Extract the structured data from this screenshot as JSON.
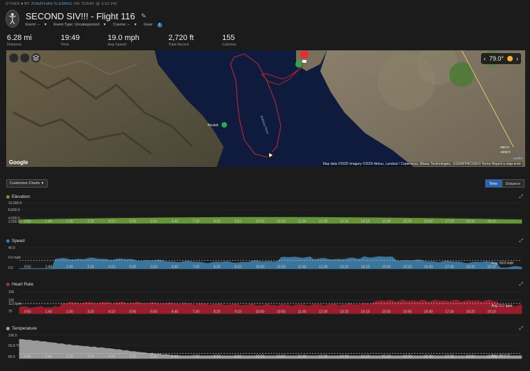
{
  "header": {
    "byline_prefix": "OTHER",
    "byline_author": "BY JONATHAN FLEMING",
    "byline_suffix": "ON TODAY @ 3:52 PM",
    "title": "SECOND SIV!!! - Flight 116",
    "event": "Event: --",
    "event_type": "Event Type: Uncategorized",
    "course": "Course: --",
    "gear": "Gear:",
    "gear_count": "1"
  },
  "stats": [
    {
      "value": "6.28 mi",
      "label": "Distance"
    },
    {
      "value": "19:49",
      "label": "Time"
    },
    {
      "value": "19.0 mph",
      "label": "Avg Speed"
    },
    {
      "value": "2,720 ft",
      "label": "Total Ascent"
    },
    {
      "value": "155",
      "label": "Calories"
    }
  ],
  "map": {
    "temperature": "79.0°",
    "attribution": "Map data ©2025 Imagery ©2025 Airbus, Landsat / Copernicus, Maxar Technologies, USDA/FPAC/GEO   Terms   Report a map error",
    "google_label": "Google",
    "scale_m": "500 m",
    "scale_ft": "2000 ft",
    "leaflet": "Leaflet",
    "river_label": "Malheur River"
  },
  "controls": {
    "customize_label": "Customize Charts",
    "time_label": "Time",
    "distance_label": "Distance"
  },
  "x_ticks": [
    "0:50",
    "1:40",
    "2:30",
    "3:20",
    "4:10",
    "5:00",
    "5:50",
    "6:40",
    "7:30",
    "8:20",
    "9:10",
    "10:00",
    "10:50",
    "11:40",
    "12:30",
    "13:20",
    "14:10",
    "15:00",
    "15:50",
    "16:40",
    "17:30",
    "18:20",
    "19:10"
  ],
  "charts": {
    "elevation": {
      "title": "Elevation",
      "color": "#6a9a3a",
      "y_labels": [
        "10,000.0",
        "8,000.0",
        "4,000.0",
        "2,000.0"
      ],
      "avg": ""
    },
    "speed": {
      "title": "Speed",
      "color": "#3d7aa3",
      "y_labels": [
        "40.0",
        "0.0 mph",
        "0.0"
      ],
      "avg": "Avg: 18.0 mph"
    },
    "heart_rate": {
      "title": "Heart Rate",
      "color": "#9e1e2e",
      "y_labels": [
        "150",
        "125",
        "113 bpm",
        "75"
      ],
      "avg": "Avg: 117 bpm"
    },
    "temperature": {
      "title": "Temperature",
      "color": "#a0a0a0",
      "y_labels": [
        "100.0",
        "96.8 °F",
        "80.0"
      ],
      "avg": "Avg: 96.0 °F"
    }
  }
}
